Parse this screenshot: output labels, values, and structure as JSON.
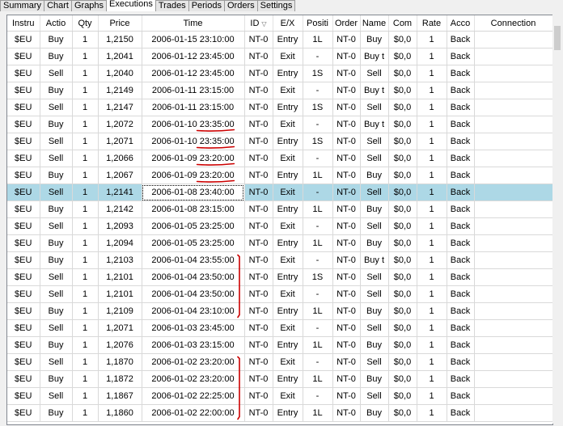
{
  "tabs": [
    {
      "label": "Summary",
      "active": false
    },
    {
      "label": "Chart",
      "active": false
    },
    {
      "label": "Graphs",
      "active": false
    },
    {
      "label": "Executions",
      "active": true
    },
    {
      "label": "Trades",
      "active": false
    },
    {
      "label": "Periods",
      "active": false
    },
    {
      "label": "Orders",
      "active": false
    },
    {
      "label": "Settings",
      "active": false
    }
  ],
  "columns": [
    "Instru",
    "Actio",
    "Qty",
    "Price",
    "Time",
    "ID",
    "E/X",
    "Positi",
    "Order",
    "Name",
    "Com",
    "Rate",
    "Acco",
    "Connection"
  ],
  "sorted_column": "ID",
  "selected_row": 9,
  "annotation_color": "#cc0000",
  "rows": [
    [
      "$EU",
      "Buy",
      "1",
      "1,2150",
      "2006-01-15 23:10:00",
      "NT-0",
      "Entry",
      "1L",
      "NT-0",
      "Buy",
      "$0,0",
      "1",
      "Back",
      ""
    ],
    [
      "$EU",
      "Buy",
      "1",
      "1,2041",
      "2006-01-12 23:45:00",
      "NT-0",
      "Exit",
      "-",
      "NT-0",
      "Buy t",
      "$0,0",
      "1",
      "Back",
      ""
    ],
    [
      "$EU",
      "Sell",
      "1",
      "1,2040",
      "2006-01-12 23:45:00",
      "NT-0",
      "Entry",
      "1S",
      "NT-0",
      "Sell",
      "$0,0",
      "1",
      "Back",
      ""
    ],
    [
      "$EU",
      "Buy",
      "1",
      "1,2149",
      "2006-01-11 23:15:00",
      "NT-0",
      "Exit",
      "-",
      "NT-0",
      "Buy t",
      "$0,0",
      "1",
      "Back",
      ""
    ],
    [
      "$EU",
      "Sell",
      "1",
      "1,2147",
      "2006-01-11 23:15:00",
      "NT-0",
      "Entry",
      "1S",
      "NT-0",
      "Sell",
      "$0,0",
      "1",
      "Back",
      ""
    ],
    [
      "$EU",
      "Buy",
      "1",
      "1,2072",
      "2006-01-10 23:35:00",
      "NT-0",
      "Exit",
      "-",
      "NT-0",
      "Buy t",
      "$0,0",
      "1",
      "Back",
      ""
    ],
    [
      "$EU",
      "Sell",
      "1",
      "1,2071",
      "2006-01-10 23:35:00",
      "NT-0",
      "Entry",
      "1S",
      "NT-0",
      "Sell",
      "$0,0",
      "1",
      "Back",
      ""
    ],
    [
      "$EU",
      "Sell",
      "1",
      "1,2066",
      "2006-01-09 23:20:00",
      "NT-0",
      "Exit",
      "-",
      "NT-0",
      "Sell",
      "$0,0",
      "1",
      "Back",
      ""
    ],
    [
      "$EU",
      "Buy",
      "1",
      "1,2067",
      "2006-01-09 23:20:00",
      "NT-0",
      "Entry",
      "1L",
      "NT-0",
      "Buy",
      "$0,0",
      "1",
      "Back",
      ""
    ],
    [
      "$EU",
      "Sell",
      "1",
      "1,2141",
      "2006-01-08 23:40:00",
      "NT-0",
      "Exit",
      "-",
      "NT-0",
      "Sell",
      "$0,0",
      "1",
      "Back",
      ""
    ],
    [
      "$EU",
      "Buy",
      "1",
      "1,2142",
      "2006-01-08 23:15:00",
      "NT-0",
      "Entry",
      "1L",
      "NT-0",
      "Buy",
      "$0,0",
      "1",
      "Back",
      ""
    ],
    [
      "$EU",
      "Sell",
      "1",
      "1,2093",
      "2006-01-05 23:25:00",
      "NT-0",
      "Exit",
      "-",
      "NT-0",
      "Sell",
      "$0,0",
      "1",
      "Back",
      ""
    ],
    [
      "$EU",
      "Buy",
      "1",
      "1,2094",
      "2006-01-05 23:25:00",
      "NT-0",
      "Entry",
      "1L",
      "NT-0",
      "Buy",
      "$0,0",
      "1",
      "Back",
      ""
    ],
    [
      "$EU",
      "Buy",
      "1",
      "1,2103",
      "2006-01-04 23:55:00",
      "NT-0",
      "Exit",
      "-",
      "NT-0",
      "Buy t",
      "$0,0",
      "1",
      "Back",
      ""
    ],
    [
      "$EU",
      "Sell",
      "1",
      "1,2101",
      "2006-01-04 23:50:00",
      "NT-0",
      "Entry",
      "1S",
      "NT-0",
      "Sell",
      "$0,0",
      "1",
      "Back",
      ""
    ],
    [
      "$EU",
      "Sell",
      "1",
      "1,2101",
      "2006-01-04 23:50:00",
      "NT-0",
      "Exit",
      "-",
      "NT-0",
      "Sell",
      "$0,0",
      "1",
      "Back",
      ""
    ],
    [
      "$EU",
      "Buy",
      "1",
      "1,2109",
      "2006-01-04 23:10:00",
      "NT-0",
      "Entry",
      "1L",
      "NT-0",
      "Buy",
      "$0,0",
      "1",
      "Back",
      ""
    ],
    [
      "$EU",
      "Sell",
      "1",
      "1,2071",
      "2006-01-03 23:45:00",
      "NT-0",
      "Exit",
      "-",
      "NT-0",
      "Sell",
      "$0,0",
      "1",
      "Back",
      ""
    ],
    [
      "$EU",
      "Buy",
      "1",
      "1,2076",
      "2006-01-03 23:15:00",
      "NT-0",
      "Entry",
      "1L",
      "NT-0",
      "Buy",
      "$0,0",
      "1",
      "Back",
      ""
    ],
    [
      "$EU",
      "Sell",
      "1",
      "1,1870",
      "2006-01-02 23:20:00",
      "NT-0",
      "Exit",
      "-",
      "NT-0",
      "Sell",
      "$0,0",
      "1",
      "Back",
      ""
    ],
    [
      "$EU",
      "Buy",
      "1",
      "1,1872",
      "2006-01-02 23:20:00",
      "NT-0",
      "Entry",
      "1L",
      "NT-0",
      "Buy",
      "$0,0",
      "1",
      "Back",
      ""
    ],
    [
      "$EU",
      "Sell",
      "1",
      "1,1867",
      "2006-01-02 22:25:00",
      "NT-0",
      "Exit",
      "-",
      "NT-0",
      "Sell",
      "$0,0",
      "1",
      "Back",
      ""
    ],
    [
      "$EU",
      "Buy",
      "1",
      "1,1860",
      "2006-01-02 22:00:00",
      "NT-0",
      "Entry",
      "1L",
      "NT-0",
      "Buy",
      "$0,0",
      "1",
      "Back",
      ""
    ]
  ]
}
